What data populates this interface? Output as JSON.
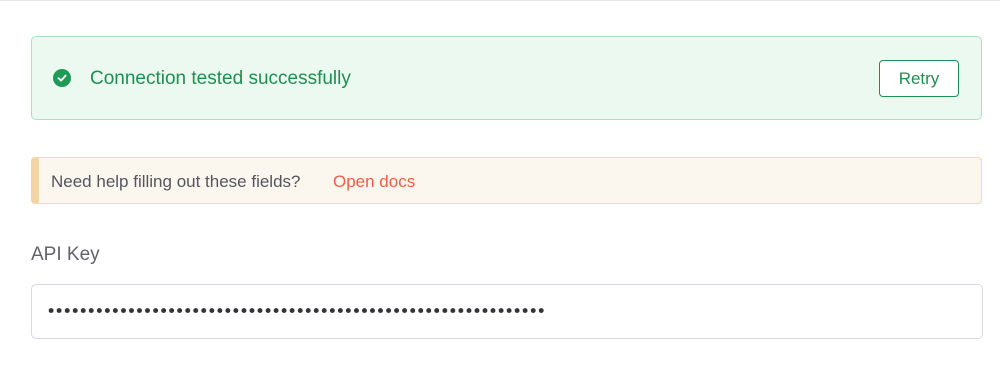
{
  "success_banner": {
    "icon": "check-circle-icon",
    "message": "Connection tested successfully",
    "retry_label": "Retry",
    "color": "#1f8f4f",
    "background": "#ebf9f1"
  },
  "help_banner": {
    "text": "Need help filling out these fields?",
    "link_label": "Open docs",
    "link_color": "#ef5d45",
    "accent": "#f3d5a4"
  },
  "api_key": {
    "label": "API Key",
    "value": "••••••••••••••••••••••••••••••••••••••••••••••••••••••••••••••"
  }
}
